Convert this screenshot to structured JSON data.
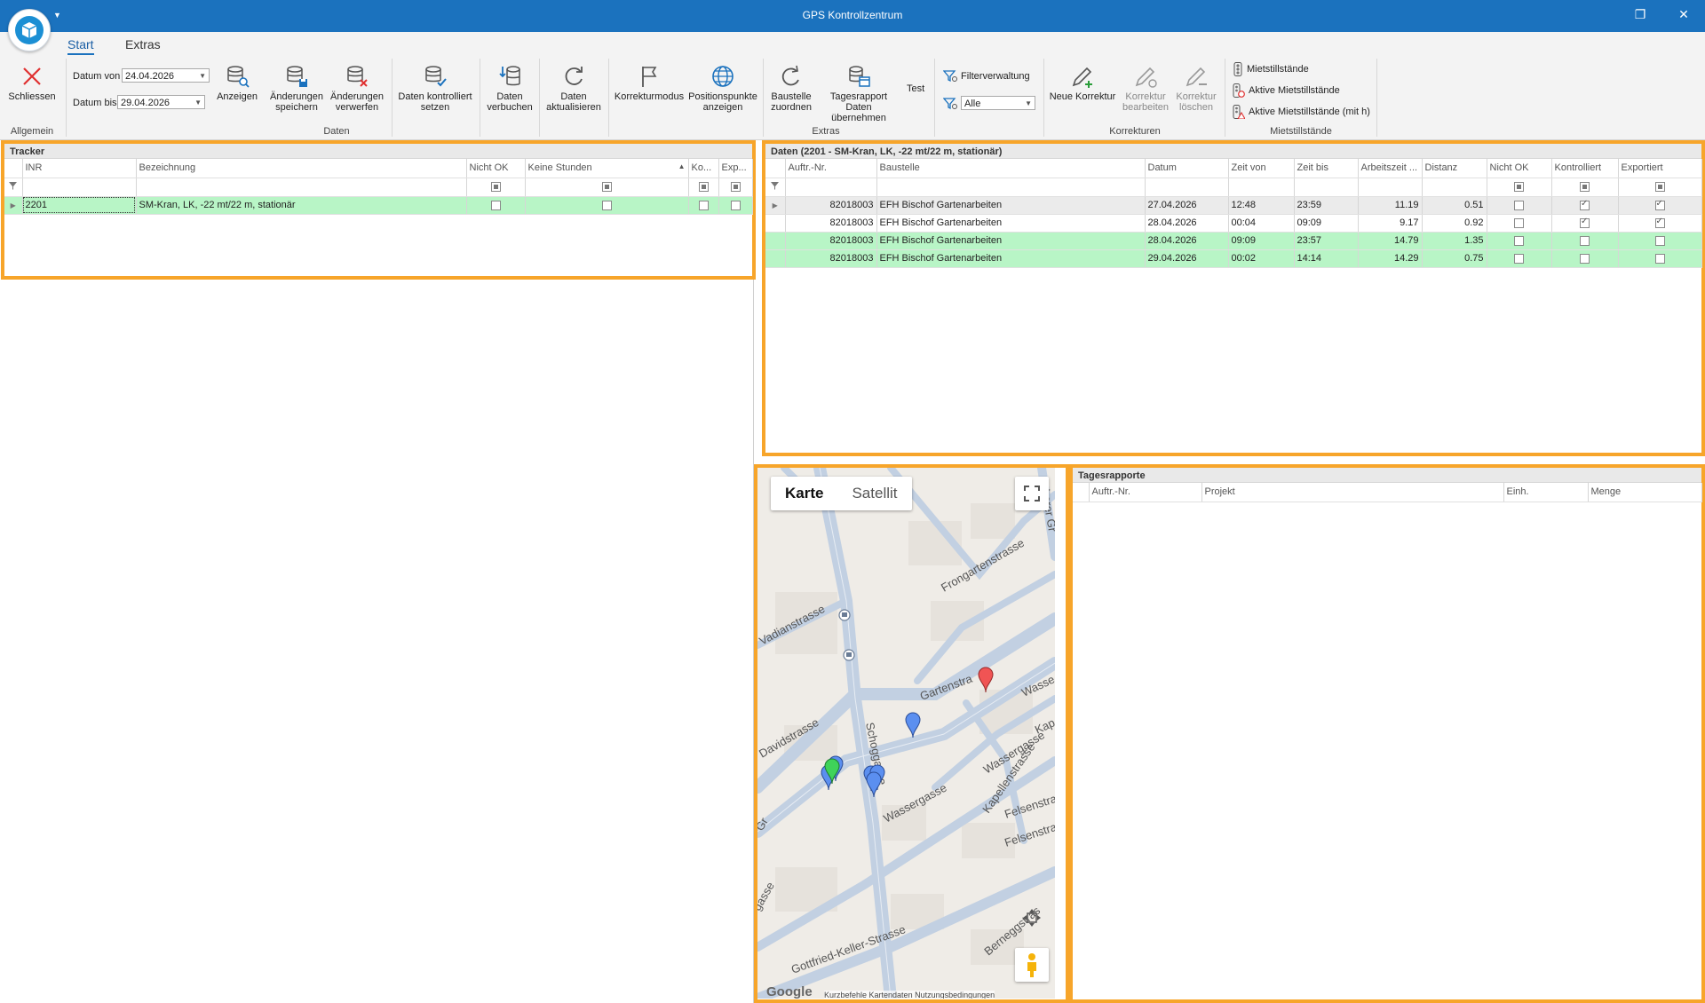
{
  "window": {
    "title": "GPS Kontrollzentrum",
    "restore_icon": "restore-icon",
    "close_icon": "close-icon"
  },
  "ribbon_tabs": [
    "Start",
    "Extras"
  ],
  "ribbon": {
    "allgemein": {
      "close_label": "Schliessen",
      "group": "Allgemein"
    },
    "daten": {
      "group": "Daten",
      "datum_von_label": "Datum von",
      "datum_von_value": "24.04.2026",
      "datum_bis_label": "Datum bis",
      "datum_bis_value": "29.04.2026",
      "show_label": "Anzeigen",
      "save_label_1": "Änderungen",
      "save_label_2": "speichern",
      "discard_label_1": "Änderungen",
      "discard_label_2": "verwerfen",
      "set_checked_label_1": "Daten kontrolliert",
      "set_checked_label_2": "setzen",
      "post_label_1": "Daten",
      "post_label_2": "verbuchen",
      "refresh_label_1": "Daten",
      "refresh_label_2": "aktualisieren"
    },
    "extras": {
      "group": "Extras",
      "korrekturmodus": "Korrekturmodus",
      "positions_1": "Positionspunkte",
      "positions_2": "anzeigen",
      "assign_1": "Baustelle",
      "assign_2": "zuordnen",
      "report_1": "Tagesrapport",
      "report_2": "Daten übernehmen",
      "test": "Test",
      "filter_label": "Filterverwaltung",
      "filter_value": "Alle"
    },
    "korrekturen": {
      "group": "Korrekturen",
      "new": "Neue Korrektur",
      "edit_1": "Korrektur",
      "edit_2": "bearbeiten",
      "delete_1": "Korrektur",
      "delete_2": "löschen"
    },
    "mietstill": {
      "group": "Mietstillstände",
      "item1": "Mietstillstände",
      "item2": "Aktive Mietstillstände",
      "item3": "Aktive Mietstillstände (mit h)"
    }
  },
  "tracker": {
    "title": "Tracker",
    "columns": [
      "INR",
      "Bezeichnung",
      "Nicht OK",
      "Keine Stunden",
      "Ko...",
      "Exp..."
    ],
    "rows": [
      {
        "inr": "2201",
        "bezeichnung": "SM-Kran, LK, -22 mt/22 m, stationär"
      }
    ]
  },
  "daten": {
    "title": "Daten (2201 - SM-Kran, LK, -22 mt/22 m, stationär)",
    "columns": [
      "Auftr.-Nr.",
      "Baustelle",
      "Datum",
      "Zeit von",
      "Zeit bis",
      "Arbeitszeit ...",
      "Distanz",
      "Nicht OK",
      "Kontrolliert",
      "Exportiert"
    ],
    "rows": [
      {
        "auftr": "82018003",
        "baustelle": "EFH Bischof Gartenarbeiten",
        "datum": "27.04.2026",
        "von": "12:48",
        "bis": "23:59",
        "arbeitszeit": "11.19",
        "distanz": "0.51",
        "nichtok": false,
        "kontrolliert": true,
        "exportiert": true
      },
      {
        "auftr": "82018003",
        "baustelle": "EFH Bischof Gartenarbeiten",
        "datum": "28.04.2026",
        "von": "00:04",
        "bis": "09:09",
        "arbeitszeit": "9.17",
        "distanz": "0.92",
        "nichtok": false,
        "kontrolliert": true,
        "exportiert": true
      },
      {
        "auftr": "82018003",
        "baustelle": "EFH Bischof Gartenarbeiten",
        "datum": "28.04.2026",
        "von": "09:09",
        "bis": "23:57",
        "arbeitszeit": "14.79",
        "distanz": "1.35",
        "nichtok": false,
        "kontrolliert": false,
        "exportiert": false
      },
      {
        "auftr": "82018003",
        "baustelle": "EFH Bischof Gartenarbeiten",
        "datum": "29.04.2026",
        "von": "00:02",
        "bis": "14:14",
        "arbeitszeit": "14.29",
        "distanz": "0.75",
        "nichtok": false,
        "kontrolliert": false,
        "exportiert": false
      }
    ]
  },
  "tagesrapporte": {
    "title": "Tagesrapporte",
    "columns": [
      "Auftr.-Nr.",
      "Projekt",
      "Einh.",
      "Menge"
    ]
  },
  "map": {
    "type_map": "Karte",
    "type_satellite": "Satellit",
    "streets": [
      "Frongartenstrasse",
      "Vadianstrasse",
      "Gartenstra",
      "Wasse",
      "Davidstrasse",
      "Schoggasse",
      "Wassergasse",
      "Wassergasse",
      "Kapellenstrasse",
      "Kap",
      "Felsenstras",
      "Felsenstrasse",
      "Gottfried-Keller-Strasse",
      "Berneggstras",
      "Oberer Gr",
      "gasse",
      "Gr"
    ],
    "google": "Google",
    "attribution": "Kurzbefehle   Kartendaten   Nutzungsbedingungen",
    "marker_colors": {
      "blue": "#5b8ff0",
      "green": "#3fd35a",
      "red": "#f05454"
    }
  },
  "colors": {
    "accent": "#1b72be",
    "highlight": "#f7a52a",
    "row_green": "#b8f5c6"
  }
}
